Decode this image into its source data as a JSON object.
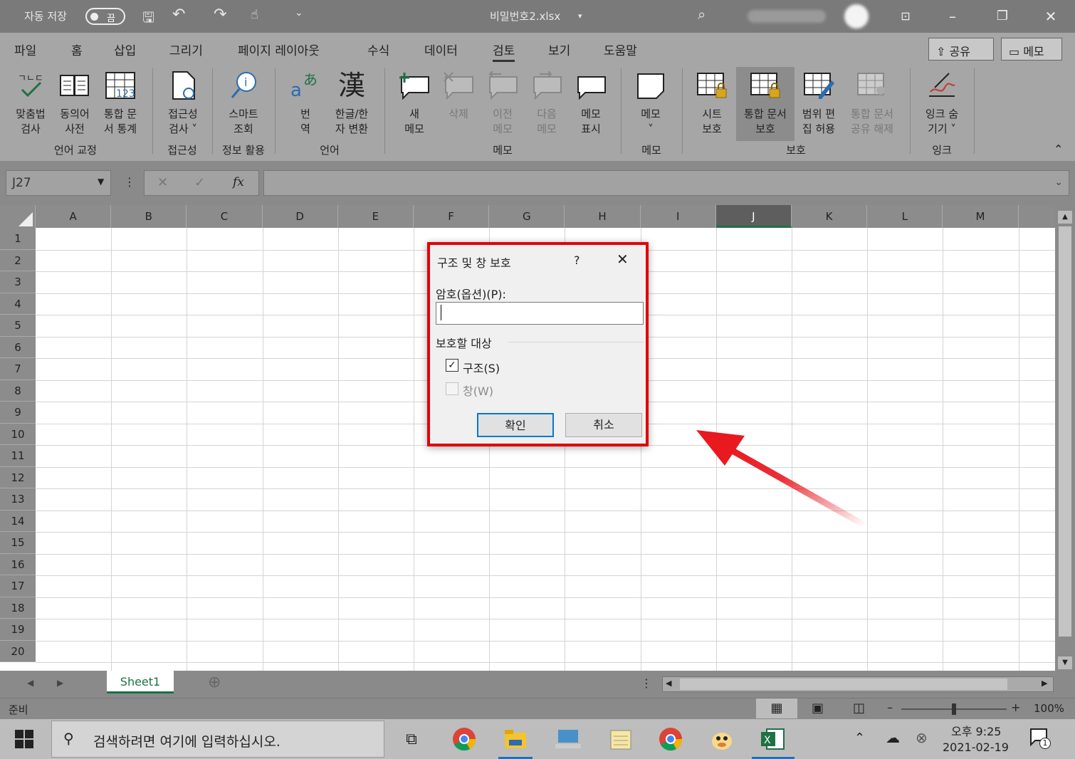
{
  "titlebar": {
    "autosave_label": "자동 저장",
    "autosave_state": "끔",
    "filename": "비밀번호2.xlsx"
  },
  "menu": {
    "items": [
      "파일",
      "홈",
      "삽입",
      "그리기",
      "페이지 레이아웃",
      "수식",
      "데이터",
      "검토",
      "보기",
      "도움말"
    ],
    "active": "검토",
    "share": "공유",
    "memo": "메모"
  },
  "ribbon": {
    "buttons": [
      {
        "l1": "맞춤법",
        "l2": "검사"
      },
      {
        "l1": "동의어",
        "l2": "사전"
      },
      {
        "l1": "통합 문",
        "l2": "서 통계"
      },
      {
        "l1": "접근성",
        "l2": "검사 ˅"
      },
      {
        "l1": "스마트",
        "l2": "조회"
      },
      {
        "l1": "번",
        "l2": "역"
      },
      {
        "l1": "한글/한",
        "l2": "자 변환"
      },
      {
        "l1": "새",
        "l2": "메모"
      },
      {
        "l1": "삭제",
        "l2": ""
      },
      {
        "l1": "이전",
        "l2": "메모"
      },
      {
        "l1": "다음",
        "l2": "메모"
      },
      {
        "l1": "메모",
        "l2": "표시"
      },
      {
        "l1": "메모",
        "l2": "˅"
      },
      {
        "l1": "시트",
        "l2": "보호"
      },
      {
        "l1": "통합 문서",
        "l2": "보호"
      },
      {
        "l1": "범위 편",
        "l2": "집 허용"
      },
      {
        "l1": "통합 문서",
        "l2": "공유 해제"
      },
      {
        "l1": "잉크 숨",
        "l2": "기기 ˅"
      }
    ],
    "groups": [
      "언어 교정",
      "접근성",
      "정보 활용",
      "언어",
      "메모",
      "메모",
      "보호",
      "잉크"
    ]
  },
  "formula_bar": {
    "name_box": "J27",
    "fx": "fx"
  },
  "sheet": {
    "columns": [
      "A",
      "B",
      "C",
      "D",
      "E",
      "F",
      "G",
      "H",
      "I",
      "J",
      "K",
      "L",
      "M"
    ],
    "selected_column": "J",
    "rows": [
      "1",
      "2",
      "3",
      "4",
      "5",
      "6",
      "7",
      "8",
      "9",
      "10",
      "11",
      "12",
      "13",
      "14",
      "15",
      "16",
      "17",
      "18",
      "19",
      "20"
    ],
    "tab": "Sheet1"
  },
  "status": {
    "ready": "준비",
    "zoom": "100%"
  },
  "dialog": {
    "title": "구조 및 창 보호",
    "help": "?",
    "password_label": "암호(옵션)(P):",
    "password_value": "",
    "section_label": "보호할 대상",
    "structure_label": "구조(S)",
    "structure_checked": true,
    "window_label": "창(W)",
    "window_checked": false,
    "ok": "확인",
    "cancel": "취소"
  },
  "taskbar": {
    "search_placeholder": "검색하려면 여기에 입력하십시오.",
    "time": "오후 9:25",
    "date": "2021-02-19",
    "notification_count": "1"
  },
  "colors": {
    "dialog_highlight": "#e0000a",
    "arrow": "#e8191f",
    "excel_green": "#1e7145"
  }
}
